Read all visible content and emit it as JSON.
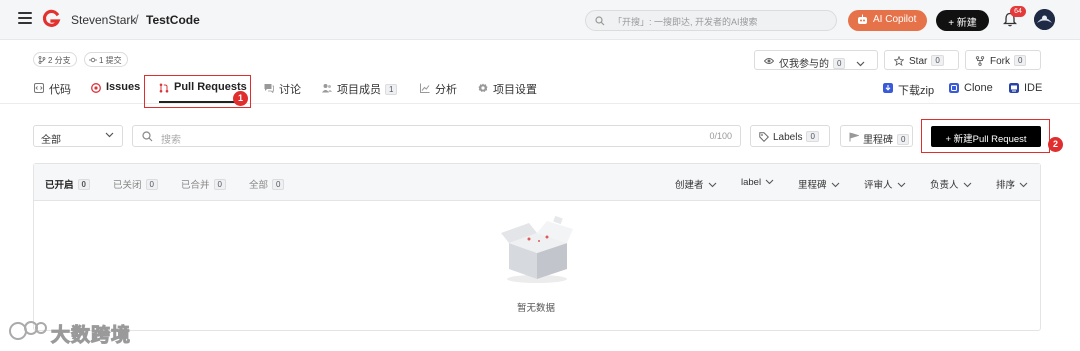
{
  "topbar": {
    "owner": "StevenStark",
    "separator": "/",
    "repo": "TestCode",
    "search_placeholder": "「开搜」: 一搜即达, 开发者的AI搜索",
    "ai_label": "AI Copilot",
    "new_label": "+ 新建",
    "notifications": "64",
    "accent": "#e6724a"
  },
  "meta": {
    "branches": "2 分支",
    "commits": "1 提交"
  },
  "actions": {
    "participate_label": "仅我参与的",
    "participate_count": "0",
    "star_label": "Star",
    "star_count": "0",
    "fork_label": "Fork",
    "fork_count": "0"
  },
  "tabs": [
    {
      "label": "代码"
    },
    {
      "label": "Issues"
    },
    {
      "label": "Pull Requests"
    },
    {
      "label": "讨论"
    },
    {
      "label": "项目成员",
      "count": "1"
    },
    {
      "label": "分析"
    },
    {
      "label": "项目设置"
    }
  ],
  "right_links": {
    "download": "下载zip",
    "clone": "Clone",
    "ide": "IDE"
  },
  "annotations": [
    "1",
    "2"
  ],
  "toolbar": {
    "select_value": "全部",
    "search_placeholder": "搜索",
    "search_limit": "0/100",
    "labels_label": "Labels",
    "labels_count": "0",
    "milestone_label": "里程碑",
    "milestone_count": "0",
    "new_pr_label": "+ 新建Pull Request"
  },
  "states": [
    {
      "label": "已开启",
      "count": "0"
    },
    {
      "label": "已关闭",
      "count": "0"
    },
    {
      "label": "已合并",
      "count": "0"
    },
    {
      "label": "全部",
      "count": "0"
    }
  ],
  "filters": [
    "创建者",
    "label",
    "里程碑",
    "评审人",
    "负责人",
    "排序"
  ],
  "empty_text": "暂无数据",
  "watermark": "大数跨境"
}
